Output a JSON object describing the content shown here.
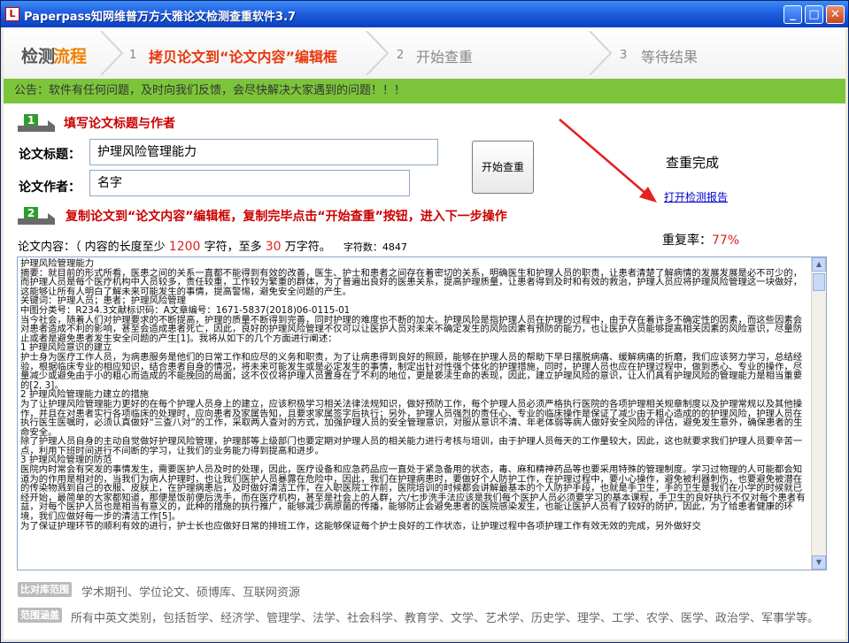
{
  "window": {
    "title": "Paperpass知网维普万方大雅论文检测查重软件3.7",
    "app_icon": "L"
  },
  "steps": {
    "heading_part1": "检测",
    "heading_part2": "流程",
    "items": [
      {
        "num": "1",
        "label": "拷贝论文到“论文内容”编辑框"
      },
      {
        "num": "2",
        "label": "开始查重"
      },
      {
        "num": "3",
        "label": "等待结果"
      }
    ]
  },
  "notice": "公告：软件有任何问题，及时向我们反馈，会尽快解决大家遇到的问题！！！",
  "section1": {
    "badge": "1",
    "title": "填写论文标题与作者"
  },
  "form": {
    "title_label": "论文标题：",
    "title_value": "护理风险管理能力",
    "author_label": "论文作者：",
    "author_value": "名字"
  },
  "start_button": "开始查重",
  "result": {
    "status": "查重完成",
    "report_link": "打开检测报告",
    "dup_label": "重复率：",
    "dup_value": "77%"
  },
  "section2": {
    "badge": "2",
    "title": "复制论文到“论文内容”编辑框，复制完毕点击“开始查重”按钮，进入下一步操作"
  },
  "content_info": {
    "label": "论文内容：（ 内容的长度至少",
    "min": "1200",
    "mid": "字符，至多",
    "max": "30",
    "suffix": "万字符。",
    "count_label": "字符数：4847"
  },
  "content_text": "护理风险管理能力\n摘要：就目前的形式所看，医患之间的关系一直都不能得到有效的改善，医生、护士和患者之间存在着密切的关系，明确医生和护理人员的职责，让患者清楚了解病情的发展发展是必不可少的，而护理人员是每个医疗机构中人员较多，责任较重，工作较为繁重的群体，为了普遍出良好的医患关系，提高护理质量，让患者得到及时和有效的救治，护理人员应将护理风险管理这一块做好，这能够让所有人明白了解未来可能发生的事情，提高警惕，避免安全问题的产生。\n关键词：护理人员；患者；护理风险管理\n中图分类号：R234.3文献标识码：A文章编号：1671-5837(2018)06-0115-01\n当今社会，随着人们对护理要求的不断提高，护理的质量不断得到完善，同时护理的难度也不断的加大。护理风险是指护理人员在护理的过程中，由于存在着许多不确定性的因素，而这些因素会对患者造成不利的影响，甚至会造成患者死亡，因此，良好的护理风险管理不仅可以让医护人员对未来不确定发生的风险因素有预防的能力，也让医护人员能够提高相关因素的风险意识，尽量防止或者是避免患者发生安全问题的产生[1]。我将从如下的几个方面进行阐述：\n1 护理风险意识的建立\n护士身为医疗工作人员，为病患服务是他们的日常工作和应尽的义务和职责，为了让病患得到良好的照顾，能够在护理人员的帮助下早日摆脱病痛、缓解病痛的折磨，我们应该努力学习，总结经验，根据临床专业的相应知识，结合患者自身的情况，将未来可能发生或是必定发生的事情，制定出针对性强个体化的护理措施，同时，护理人员也应在护理过程中，做到悉心、专业的操作，尽量减少或避免由于小的粗心而造成的不能挽回的局面，这不仅仅将护理人员置身在了不利的地位，更是亵渎生命的表现，因此，建立护理风险的意识，让人们具有护理风险的管理能力是相当重要的[2, 3]。\n2 护理风险管理能力建立的措施\n为了让护理风险管理能力更好的在每个护理人员身上的建立，应该积极学习相关法律法规知识，做好预防工作，每个护理人员必须严格执行医院的各项护理相关规章制度以及护理常规以及其他操作，并且在对患者实行各项临床的处理时，应向患者及家属告知，且要求家属签字后执行；另外，护理人员强烈的责任心、专业的临床操作是保证了减少由于粗心造成的的护理风险，护理人员在执行医生医嘱时，必须认真做好“三查八对”的工作，采取两人查对的方式，加强护理人员的安全管理意识，对服从意识不清、年老体弱等病人做好安全风险的评估，避免发生意外，确保患者的生命安全。\n除了护理人员自身的主动自觉做好护理风险管理，护理部等上级部门也要定期对护理人员的相关能力进行考核与培训，由于护理人员每天的工作量较大，因此，这也就要求我们护理人员要辛苦一点，利用下班时间进行不间断的学习，让我们的业务能力得到提高和进步。\n3 护理风险管理的防范\n医院内时常会有突发的事情发生，需要医护人员及时的处理，因此，医疗设备和应急药品应一直处于紧急备用的状态，毒、麻和精神药品等也要采用特殊的管理制度。学习过物理的人可能都会知道为的作用是相对的，当我们为病人护理时，也让我们医护人员暴露在危险中，因此，我们在护理病患时，要做好个人防护工作，在护理过程中，要小心操作，避免被利器刺伤，也要避免被潜在的传染物溅到自己的衣服、皮肤上，在护理病患后，及时做好清洁工作，在入职医院工作前，医院培训的时候都会讲解最基本的个人防护手段，也就是手卫生，手的卫生是我们在小学的时候就已经开始，最简单的大家都知道，那便是饭前便后洗手，而在医疗机构，甚至是社会上的人群，六/七步洗手法应该是我们每个医护人员必须要学习的基本课程，手卫生的良好执行不仅对每个患者有益，对每个医护人员也是相当有意义的，此种的措施的执行推广，能够减少病原菌的传播，能够防止会避免患者的医院感染发生，也能让医护人员有了较好的防护，因此，为了给患者健康的环境，我们应做好每一步的清洁工作[5]。\n为了保证护理环节的顺利有效的进行，护士长也应做好日常的排班工作，这能够保证每个护士良好的工作状态，让护理过程中各项护理工作有效无效的完成，另外做好交",
  "footer": {
    "tag1": "比对库范围",
    "text1": "学术期刊、学位论文、硕博库、互联网资源",
    "tag2": "范围涵盖",
    "text2": "所有中英文类别，包括哲学、经济学、管理学、法学、社会科学、教育学、文学、艺术学、历史学、理学、工学、农学、医学、政治学、军事学等。"
  },
  "colors": {
    "accent": "#f08200",
    "notice_bg": "#7cc53a",
    "warn_red": "#cc0000",
    "link": "#0000cc"
  }
}
